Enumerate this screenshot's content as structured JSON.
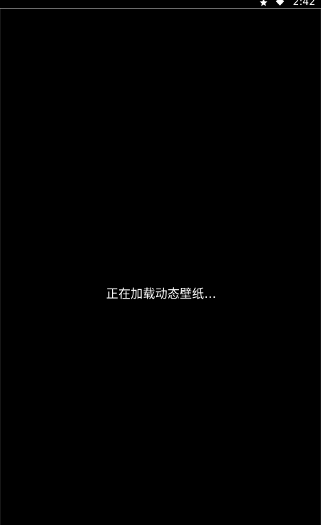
{
  "status_bar": {
    "time": "2:42",
    "icons": [
      "star-icon",
      "wifi-icon"
    ]
  },
  "main": {
    "loading_message": "正在加载动态壁纸..."
  },
  "colors": {
    "background": "#000000",
    "text": "#ffffff",
    "divider": "#9a9a9a"
  }
}
